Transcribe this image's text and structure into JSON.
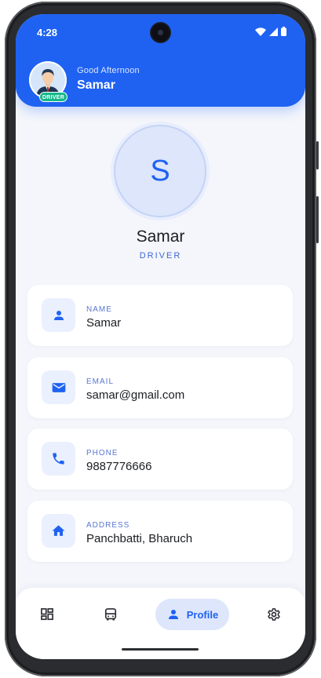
{
  "status_bar": {
    "time": "4:28",
    "icons": [
      "wifi-icon",
      "signal-icon",
      "battery-icon"
    ]
  },
  "header": {
    "greeting": "Good Afternoon",
    "name": "Samar",
    "badge": "DRIVER",
    "color": "#1f62f2"
  },
  "profile": {
    "initial": "S",
    "name": "Samar",
    "role": "DRIVER"
  },
  "fields": [
    {
      "label": "NAME",
      "value": "Samar",
      "icon": "person-icon"
    },
    {
      "label": "EMAIL",
      "value": "samar@gmail.com",
      "icon": "mail-icon"
    },
    {
      "label": "PHONE",
      "value": "9887776666",
      "icon": "phone-icon"
    },
    {
      "label": "ADDRESS",
      "value": "Panchbatti, Bharuch",
      "icon": "home-icon"
    }
  ],
  "bottom_nav": {
    "items": [
      {
        "icon": "dashboard-icon",
        "active": false
      },
      {
        "icon": "bus-icon",
        "active": false
      },
      {
        "icon": "person-icon",
        "label": "Profile",
        "active": true
      },
      {
        "icon": "gear-icon",
        "active": false
      }
    ]
  },
  "colors": {
    "accent": "#1f62f2",
    "badge": "#14b88a",
    "background": "#f4f6fb"
  }
}
